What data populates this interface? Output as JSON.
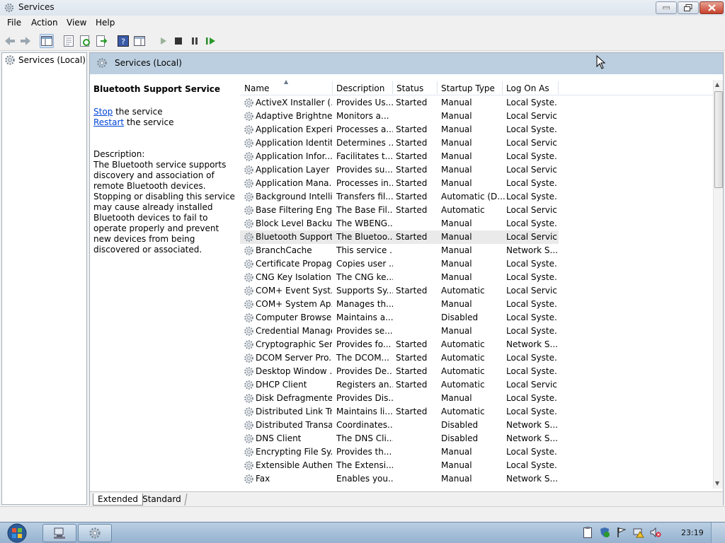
{
  "window": {
    "title": "Services"
  },
  "menu": {
    "file": "File",
    "action": "Action",
    "view": "View",
    "help": "Help"
  },
  "tree": {
    "root_label": "Services (Local)"
  },
  "pane": {
    "header_title": "Services (Local)"
  },
  "detail": {
    "service_name": "Bluetooth Support Service",
    "stop_link": "Stop",
    "stop_suffix": " the service",
    "restart_link": "Restart",
    "restart_suffix": " the service",
    "description_label": "Description:",
    "description_text": "The Bluetooth service supports discovery and association of remote Bluetooth devices.  Stopping or disabling this service may cause already installed Bluetooth devices to fail to operate properly and prevent new devices from being discovered or associated."
  },
  "table": {
    "columns": [
      "Name",
      "Description",
      "Status",
      "Startup Type",
      "Log On As"
    ],
    "rows": [
      [
        "ActiveX Installer (...",
        "Provides Us...",
        "Started",
        "Manual",
        "Local Syste..."
      ],
      [
        "Adaptive Brightness",
        "Monitors a...",
        "",
        "Manual",
        "Local Service"
      ],
      [
        "Application Experi...",
        "Processes a...",
        "Started",
        "Manual",
        "Local Syste..."
      ],
      [
        "Application Identity",
        "Determines ...",
        "Started",
        "Manual",
        "Local Service"
      ],
      [
        "Application Infor...",
        "Facilitates t...",
        "Started",
        "Manual",
        "Local Syste..."
      ],
      [
        "Application Layer ...",
        "Provides su...",
        "Started",
        "Manual",
        "Local Service"
      ],
      [
        "Application Mana...",
        "Processes in...",
        "Started",
        "Manual",
        "Local Syste..."
      ],
      [
        "Background Intelli...",
        "Transfers fil...",
        "Started",
        "Automatic (D...",
        "Local Syste..."
      ],
      [
        "Base Filtering Engi...",
        "The Base Fil...",
        "Started",
        "Automatic",
        "Local Service"
      ],
      [
        "Block Level Backu...",
        "The WBENG...",
        "",
        "Manual",
        "Local Syste..."
      ],
      [
        "Bluetooth Support...",
        "The Bluetoo...",
        "Started",
        "Manual",
        "Local Service"
      ],
      [
        "BranchCache",
        "This service ...",
        "",
        "Manual",
        "Network S..."
      ],
      [
        "Certificate Propag...",
        "Copies user ...",
        "",
        "Manual",
        "Local Syste..."
      ],
      [
        "CNG Key Isolation",
        "The CNG ke...",
        "",
        "Manual",
        "Local Syste..."
      ],
      [
        "COM+ Event Syst...",
        "Supports Sy...",
        "Started",
        "Automatic",
        "Local Service"
      ],
      [
        "COM+ System Ap...",
        "Manages th...",
        "",
        "Manual",
        "Local Syste..."
      ],
      [
        "Computer Browser",
        "Maintains a...",
        "",
        "Disabled",
        "Local Syste..."
      ],
      [
        "Credential Manager",
        "Provides se...",
        "",
        "Manual",
        "Local Syste..."
      ],
      [
        "Cryptographic Ser...",
        "Provides fo...",
        "Started",
        "Automatic",
        "Network S..."
      ],
      [
        "DCOM Server Pro...",
        "The DCOM...",
        "Started",
        "Automatic",
        "Local Syste..."
      ],
      [
        "Desktop Window ...",
        "Provides De...",
        "Started",
        "Automatic",
        "Local Syste..."
      ],
      [
        "DHCP Client",
        "Registers an...",
        "Started",
        "Automatic",
        "Local Service"
      ],
      [
        "Disk Defragmenter",
        "Provides Dis...",
        "",
        "Manual",
        "Local Syste..."
      ],
      [
        "Distributed Link Tr...",
        "Maintains li...",
        "Started",
        "Automatic",
        "Local Syste..."
      ],
      [
        "Distributed Transa...",
        "Coordinates...",
        "",
        "Disabled",
        "Network S..."
      ],
      [
        "DNS Client",
        "The DNS Cli...",
        "",
        "Disabled",
        "Network S..."
      ],
      [
        "Encrypting File Sy...",
        "Provides th...",
        "",
        "Manual",
        "Local Syste..."
      ],
      [
        "Extensible Authen...",
        "The Extensi...",
        "",
        "Manual",
        "Local Syste..."
      ],
      [
        "Fax",
        "Enables you...",
        "",
        "Manual",
        "Network S..."
      ]
    ],
    "selected_row": 10
  },
  "tabs": {
    "extended": "Extended",
    "standard": "Standard"
  },
  "taskbar": {
    "clock": "23:19"
  },
  "colors": {
    "pane_header": "#bccfe0",
    "link": "#0046d5",
    "selection": "#eaeaea"
  }
}
